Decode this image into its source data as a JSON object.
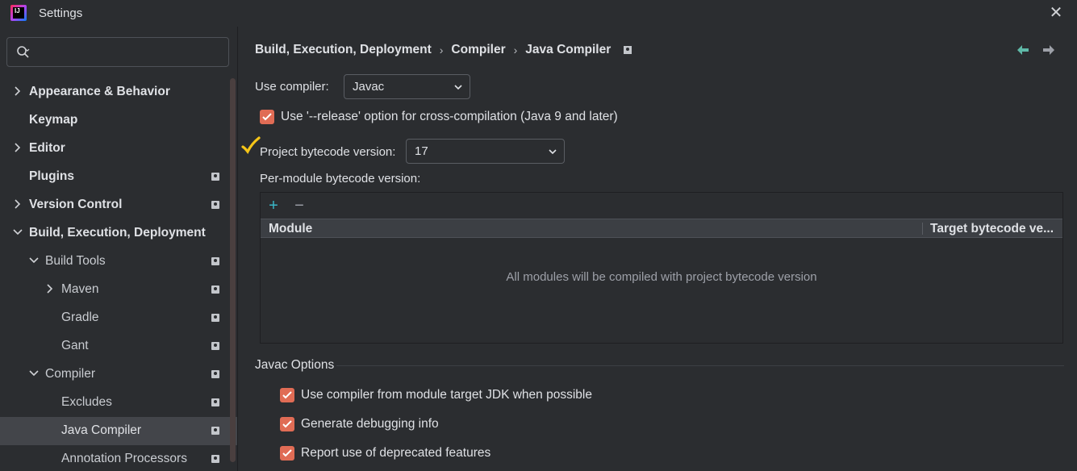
{
  "window": {
    "title": "Settings",
    "icon": "intellij-idea-icon"
  },
  "search": {
    "placeholder": "",
    "value": ""
  },
  "sidebar": {
    "items": [
      {
        "label": "Appearance & Behavior",
        "expandable": true,
        "expanded": false,
        "level": 0,
        "bold": true,
        "badge": false
      },
      {
        "label": "Keymap",
        "expandable": false,
        "level": 0,
        "bold": true,
        "badge": false
      },
      {
        "label": "Editor",
        "expandable": true,
        "expanded": false,
        "level": 0,
        "bold": true,
        "badge": false
      },
      {
        "label": "Plugins",
        "expandable": false,
        "level": 0,
        "bold": true,
        "badge": true
      },
      {
        "label": "Version Control",
        "expandable": true,
        "expanded": false,
        "level": 0,
        "bold": true,
        "badge": true
      },
      {
        "label": "Build, Execution, Deployment",
        "expandable": true,
        "expanded": true,
        "level": 0,
        "bold": true,
        "badge": false
      },
      {
        "label": "Build Tools",
        "expandable": true,
        "expanded": true,
        "level": 1,
        "bold": false,
        "badge": true
      },
      {
        "label": "Maven",
        "expandable": true,
        "expanded": false,
        "level": 2,
        "bold": false,
        "badge": true
      },
      {
        "label": "Gradle",
        "expandable": false,
        "level": 2,
        "bold": false,
        "badge": true
      },
      {
        "label": "Gant",
        "expandable": false,
        "level": 2,
        "bold": false,
        "badge": true
      },
      {
        "label": "Compiler",
        "expandable": true,
        "expanded": true,
        "level": 1,
        "bold": false,
        "badge": true
      },
      {
        "label": "Excludes",
        "expandable": false,
        "level": 2,
        "bold": false,
        "badge": true
      },
      {
        "label": "Java Compiler",
        "expandable": false,
        "level": 2,
        "bold": false,
        "badge": true,
        "selected": true
      },
      {
        "label": "Annotation Processors",
        "expandable": false,
        "level": 2,
        "bold": false,
        "badge": true
      }
    ]
  },
  "breadcrumb": {
    "items": [
      "Build, Execution, Deployment",
      "Compiler",
      "Java Compiler"
    ],
    "separator": "›"
  },
  "compiler": {
    "use_compiler_label": "Use compiler:",
    "use_compiler_value": "Javac",
    "release_option_label": "Use '--release' option for cross-compilation (Java 9 and later)",
    "release_option_checked": true,
    "project_bytecode_label": "Project bytecode version:",
    "project_bytecode_value": "17",
    "per_module_label": "Per-module bytecode version:"
  },
  "module_table": {
    "add_label": "+",
    "remove_label": "−",
    "columns": [
      "Module",
      "Target bytecode ve..."
    ],
    "empty_text": "All modules will be compiled with project bytecode version"
  },
  "javac_options": {
    "title": "Javac Options",
    "options": [
      {
        "label": "Use compiler from module target JDK when possible",
        "checked": true
      },
      {
        "label": "Generate debugging info",
        "checked": true
      },
      {
        "label": "Report use of deprecated features",
        "checked": true
      }
    ]
  },
  "colors": {
    "background": "#2b2d30",
    "checkbox": "#e06c55",
    "selection": "#43454a",
    "accent_plus": "#3ab7c8",
    "nav_back": "#5fb9a8",
    "annotation_check": "#f5c518"
  }
}
